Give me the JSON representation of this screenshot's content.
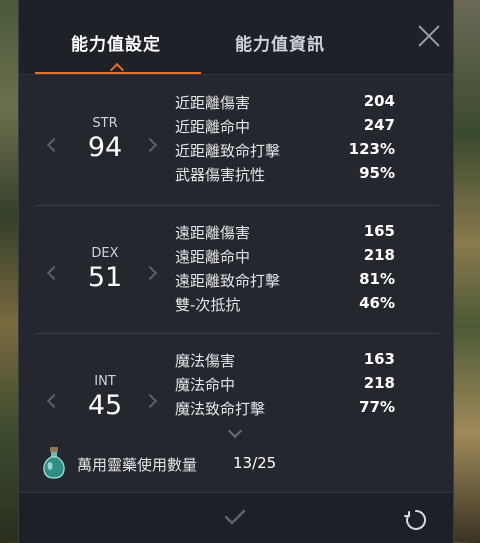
{
  "tabs": {
    "settings_label": "能力值設定",
    "info_label": "能力值資訊"
  },
  "stats": [
    {
      "name": "STR",
      "value": "94",
      "rows": [
        {
          "label": "近距離傷害",
          "value": "204"
        },
        {
          "label": "近距離命中",
          "value": "247"
        },
        {
          "label": "近距離致命打擊",
          "value": "123%"
        },
        {
          "label": "武器傷害抗性",
          "value": "95%"
        }
      ]
    },
    {
      "name": "DEX",
      "value": "51",
      "rows": [
        {
          "label": "遠距離傷害",
          "value": "165"
        },
        {
          "label": "遠距離命中",
          "value": "218"
        },
        {
          "label": "遠距離致命打擊",
          "value": "81%"
        },
        {
          "label": "雙-次抵抗",
          "value": "46%"
        }
      ]
    },
    {
      "name": "INT",
      "value": "45",
      "rows": [
        {
          "label": "魔法傷害",
          "value": "163"
        },
        {
          "label": "魔法命中",
          "value": "218"
        },
        {
          "label": "魔法致命打擊",
          "value": "77%"
        }
      ]
    }
  ],
  "elixir": {
    "label": "萬用靈藥使用數量",
    "count": "13/25"
  },
  "colors": {
    "accent": "#e0712e",
    "panel_bg": "#24272e",
    "text": "#e4e6ea"
  },
  "icons": {
    "close": "close-icon",
    "confirm": "checkmark-icon",
    "reset": "reset-icon",
    "potion": "potion-icon"
  }
}
